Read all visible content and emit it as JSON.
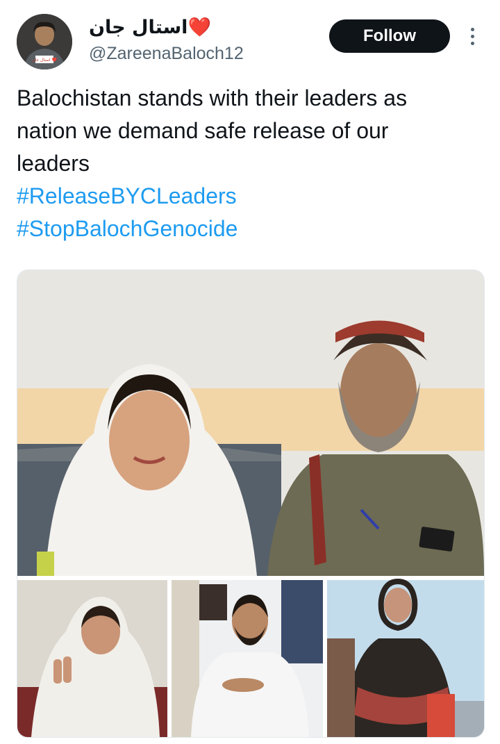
{
  "user": {
    "display_name": "استال جان❤️",
    "handle": "@ZareenaBaloch12",
    "avatar_badge": "استال جان ❤️"
  },
  "actions": {
    "follow_label": "Follow",
    "more_icon": "more-vertical-icon"
  },
  "tweet": {
    "lines": [
      "Balochistan stands with their leaders as",
      "nation we demand safe release of our",
      "leaders"
    ],
    "hashtags": [
      "#ReleaseBYCLeaders",
      "#StopBalochGenocide"
    ]
  },
  "colors": {
    "text": "#0f1419",
    "secondary": "#536471",
    "link": "#1d9bf0",
    "follow_bg": "#0f1419"
  }
}
